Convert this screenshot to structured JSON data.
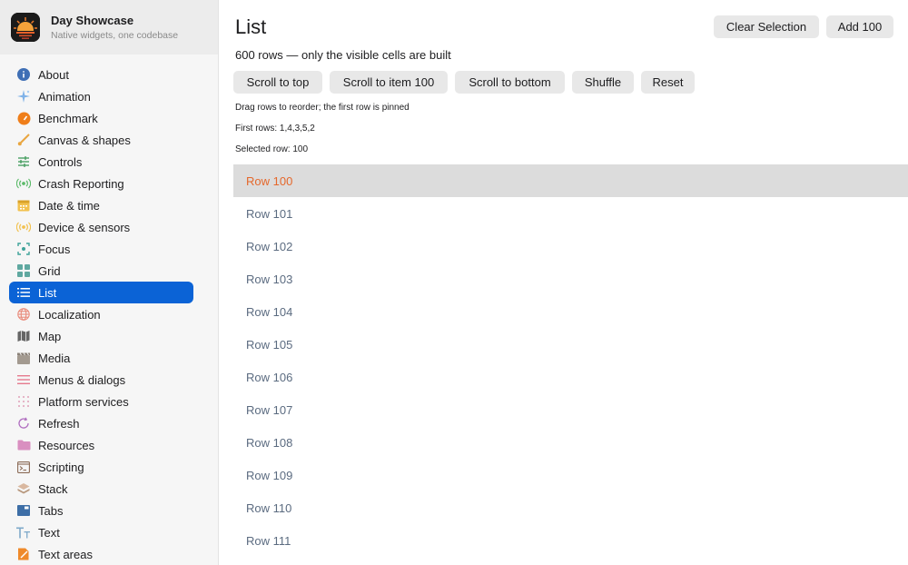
{
  "app": {
    "title": "Day Showcase",
    "subtitle": "Native widgets, one codebase"
  },
  "sidebar": {
    "items": [
      {
        "label": "About",
        "icon": "info-icon"
      },
      {
        "label": "Animation",
        "icon": "sparkles-icon"
      },
      {
        "label": "Benchmark",
        "icon": "speedometer-icon"
      },
      {
        "label": "Canvas & shapes",
        "icon": "brush-icon"
      },
      {
        "label": "Controls",
        "icon": "sliders-icon"
      },
      {
        "label": "Crash Reporting",
        "icon": "broadcast-icon"
      },
      {
        "label": "Date & time",
        "icon": "calendar-icon"
      },
      {
        "label": "Device & sensors",
        "icon": "sensor-icon"
      },
      {
        "label": "Focus",
        "icon": "focus-icon"
      },
      {
        "label": "Grid",
        "icon": "grid-icon"
      },
      {
        "label": "List",
        "icon": "list-icon",
        "active": true
      },
      {
        "label": "Localization",
        "icon": "globe-icon"
      },
      {
        "label": "Map",
        "icon": "map-icon"
      },
      {
        "label": "Media",
        "icon": "film-icon"
      },
      {
        "label": "Menus & dialogs",
        "icon": "menu-icon"
      },
      {
        "label": "Platform services",
        "icon": "dots-grid-icon"
      },
      {
        "label": "Refresh",
        "icon": "refresh-icon"
      },
      {
        "label": "Resources",
        "icon": "folder-icon"
      },
      {
        "label": "Scripting",
        "icon": "terminal-icon"
      },
      {
        "label": "Stack",
        "icon": "stack-icon"
      },
      {
        "label": "Tabs",
        "icon": "tabs-icon"
      },
      {
        "label": "Text",
        "icon": "text-icon"
      },
      {
        "label": "Text areas",
        "icon": "text-area-icon"
      }
    ]
  },
  "main": {
    "title": "List",
    "clear_selection_label": "Clear Selection",
    "add_100_label": "Add 100",
    "subtitle": "600 rows — only the visible cells are built",
    "buttons": {
      "scroll_top": "Scroll to top",
      "scroll_item": "Scroll to item 100",
      "scroll_bottom": "Scroll to bottom",
      "shuffle": "Shuffle",
      "reset": "Reset"
    },
    "hint": "Drag rows to reorder; the first row is pinned",
    "first_rows": "First rows: 1,4,3,5,2",
    "selected_row": "Selected row: 100",
    "rows": [
      "Row 100",
      "Row 101",
      "Row 102",
      "Row 103",
      "Row 104",
      "Row 105",
      "Row 106",
      "Row 107",
      "Row 108",
      "Row 109",
      "Row 110",
      "Row 111"
    ],
    "selected_index": 0
  },
  "colors": {
    "accent": "#0b63d6",
    "selected_row_bg": "#dcdcdc",
    "selected_row_text": "#e5682c",
    "row_text": "#5b6b80"
  }
}
